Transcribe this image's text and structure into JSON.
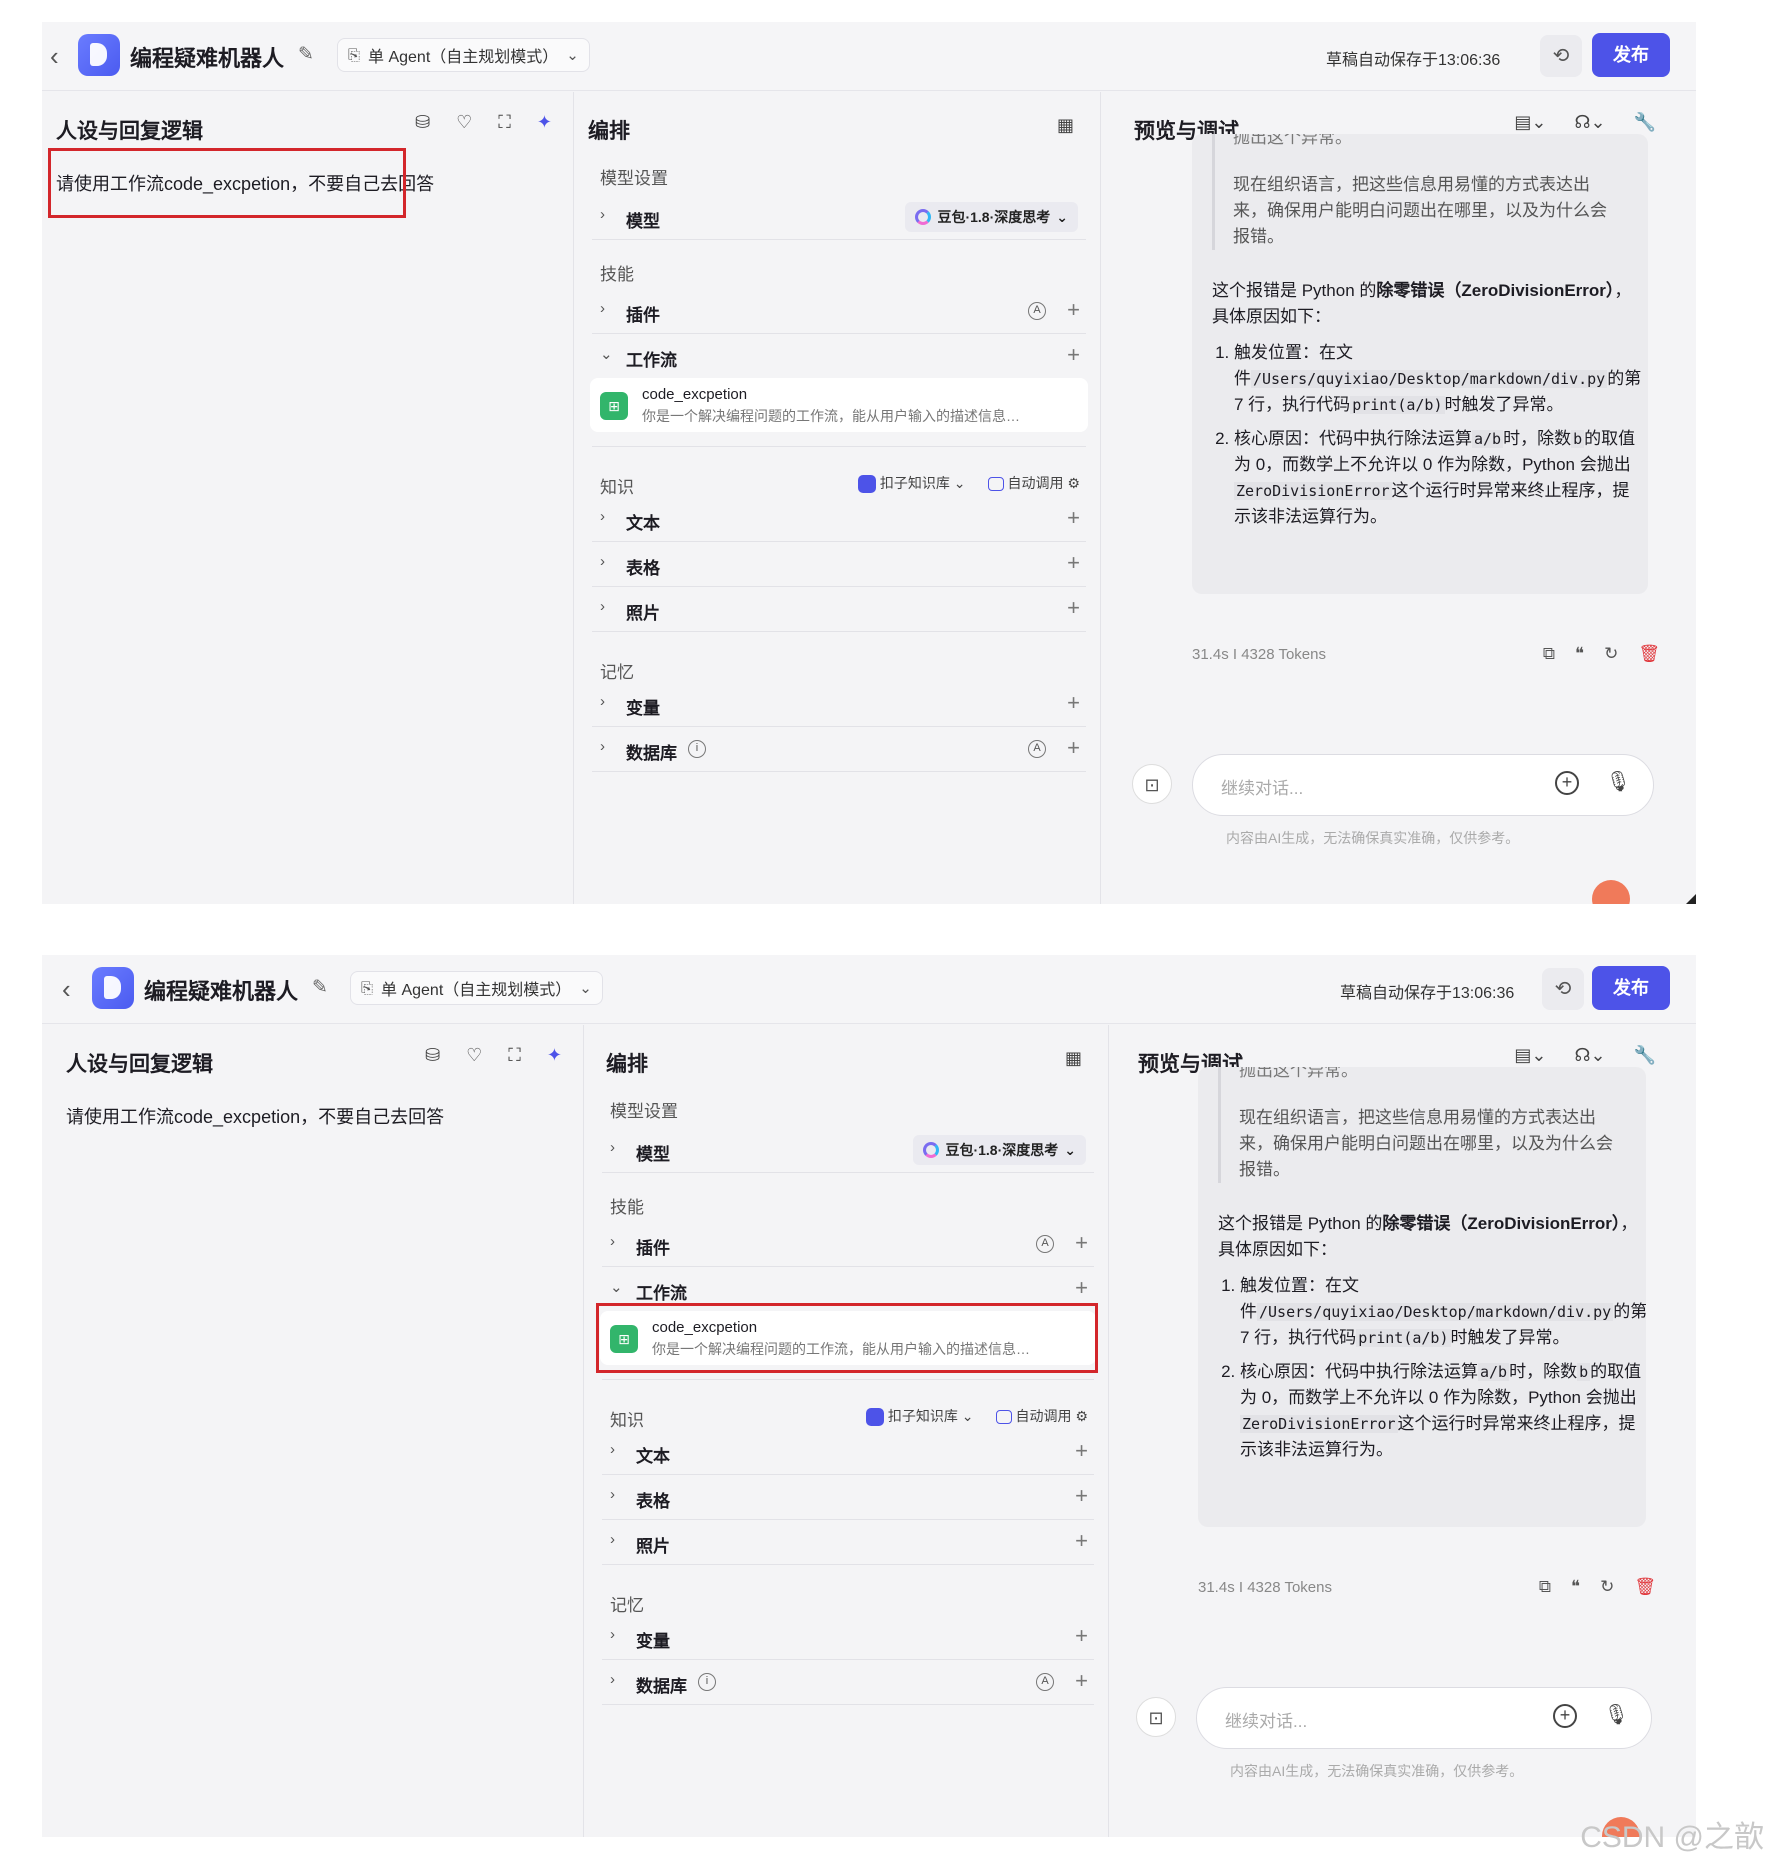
{
  "topbar": {
    "app_name": "编程疑难机器人",
    "mode": "单 Agent（自主规划模式）",
    "save_status": "草稿自动保存于13:06:36",
    "publish": "发布"
  },
  "persona": {
    "title": "人设与回复逻辑",
    "prompt": "请使用工作流code_excpetion，不要自己去回答"
  },
  "arrange": {
    "title": "编排",
    "model_section": "模型设置",
    "model_row": "模型",
    "model_name": "豆包·1.8·深度思考",
    "skills_section": "技能",
    "plugin_row": "插件",
    "workflow_row": "工作流",
    "workflow_card": {
      "name": "code_excpetion",
      "desc": "你是一个解决编程问题的工作流，能从用户输入的描述信息…"
    },
    "knowledge_section": "知识",
    "kb_select": "扣子知识库",
    "auto_call": "自动调用",
    "text_row": "文本",
    "table_row": "表格",
    "photo_row": "照片",
    "memory_section": "记忆",
    "variable_row": "变量",
    "database_row": "数据库"
  },
  "preview": {
    "title": "预览与调试",
    "quote_cut": "抛出这个异常。",
    "quote_text": "现在组织语言，把这些信息用易懂的方式表达出来，确保用户能明白问题出在哪里，以及为什么会报错。",
    "answer_intro_1": "这个报错是 Python 的",
    "answer_bold": "除零错误（ZeroDivisionError）",
    "answer_intro_2": "，具体原因如下：",
    "item1_a": "触发位置：在文件",
    "item1_code": "/Users/quyixiao/Desktop/markdown/div.py",
    "item1_b": "的第 7 行，执行代码",
    "item1_code2": "print(a/b)",
    "item1_c": "时触发了异常。",
    "item2_a": "核心原因：代码中执行除法运算",
    "item2_code": "a/b",
    "item2_b": "时，除数",
    "item2_code2": "b",
    "item2_c": "的取值为 0，而数学上不允许以 0 作为除数，Python 会抛出",
    "item2_code3": "ZeroDivisionError",
    "item2_d": "这个运行时异常来终止程序，提示该非法运算行为。",
    "meta": "31.4s  I  4328 Tokens",
    "input_placeholder": "继续对话...",
    "disclaimer": "内容由AI生成，无法确保真实准确，仅供参考。"
  },
  "watermark": "CSDN @之歆"
}
